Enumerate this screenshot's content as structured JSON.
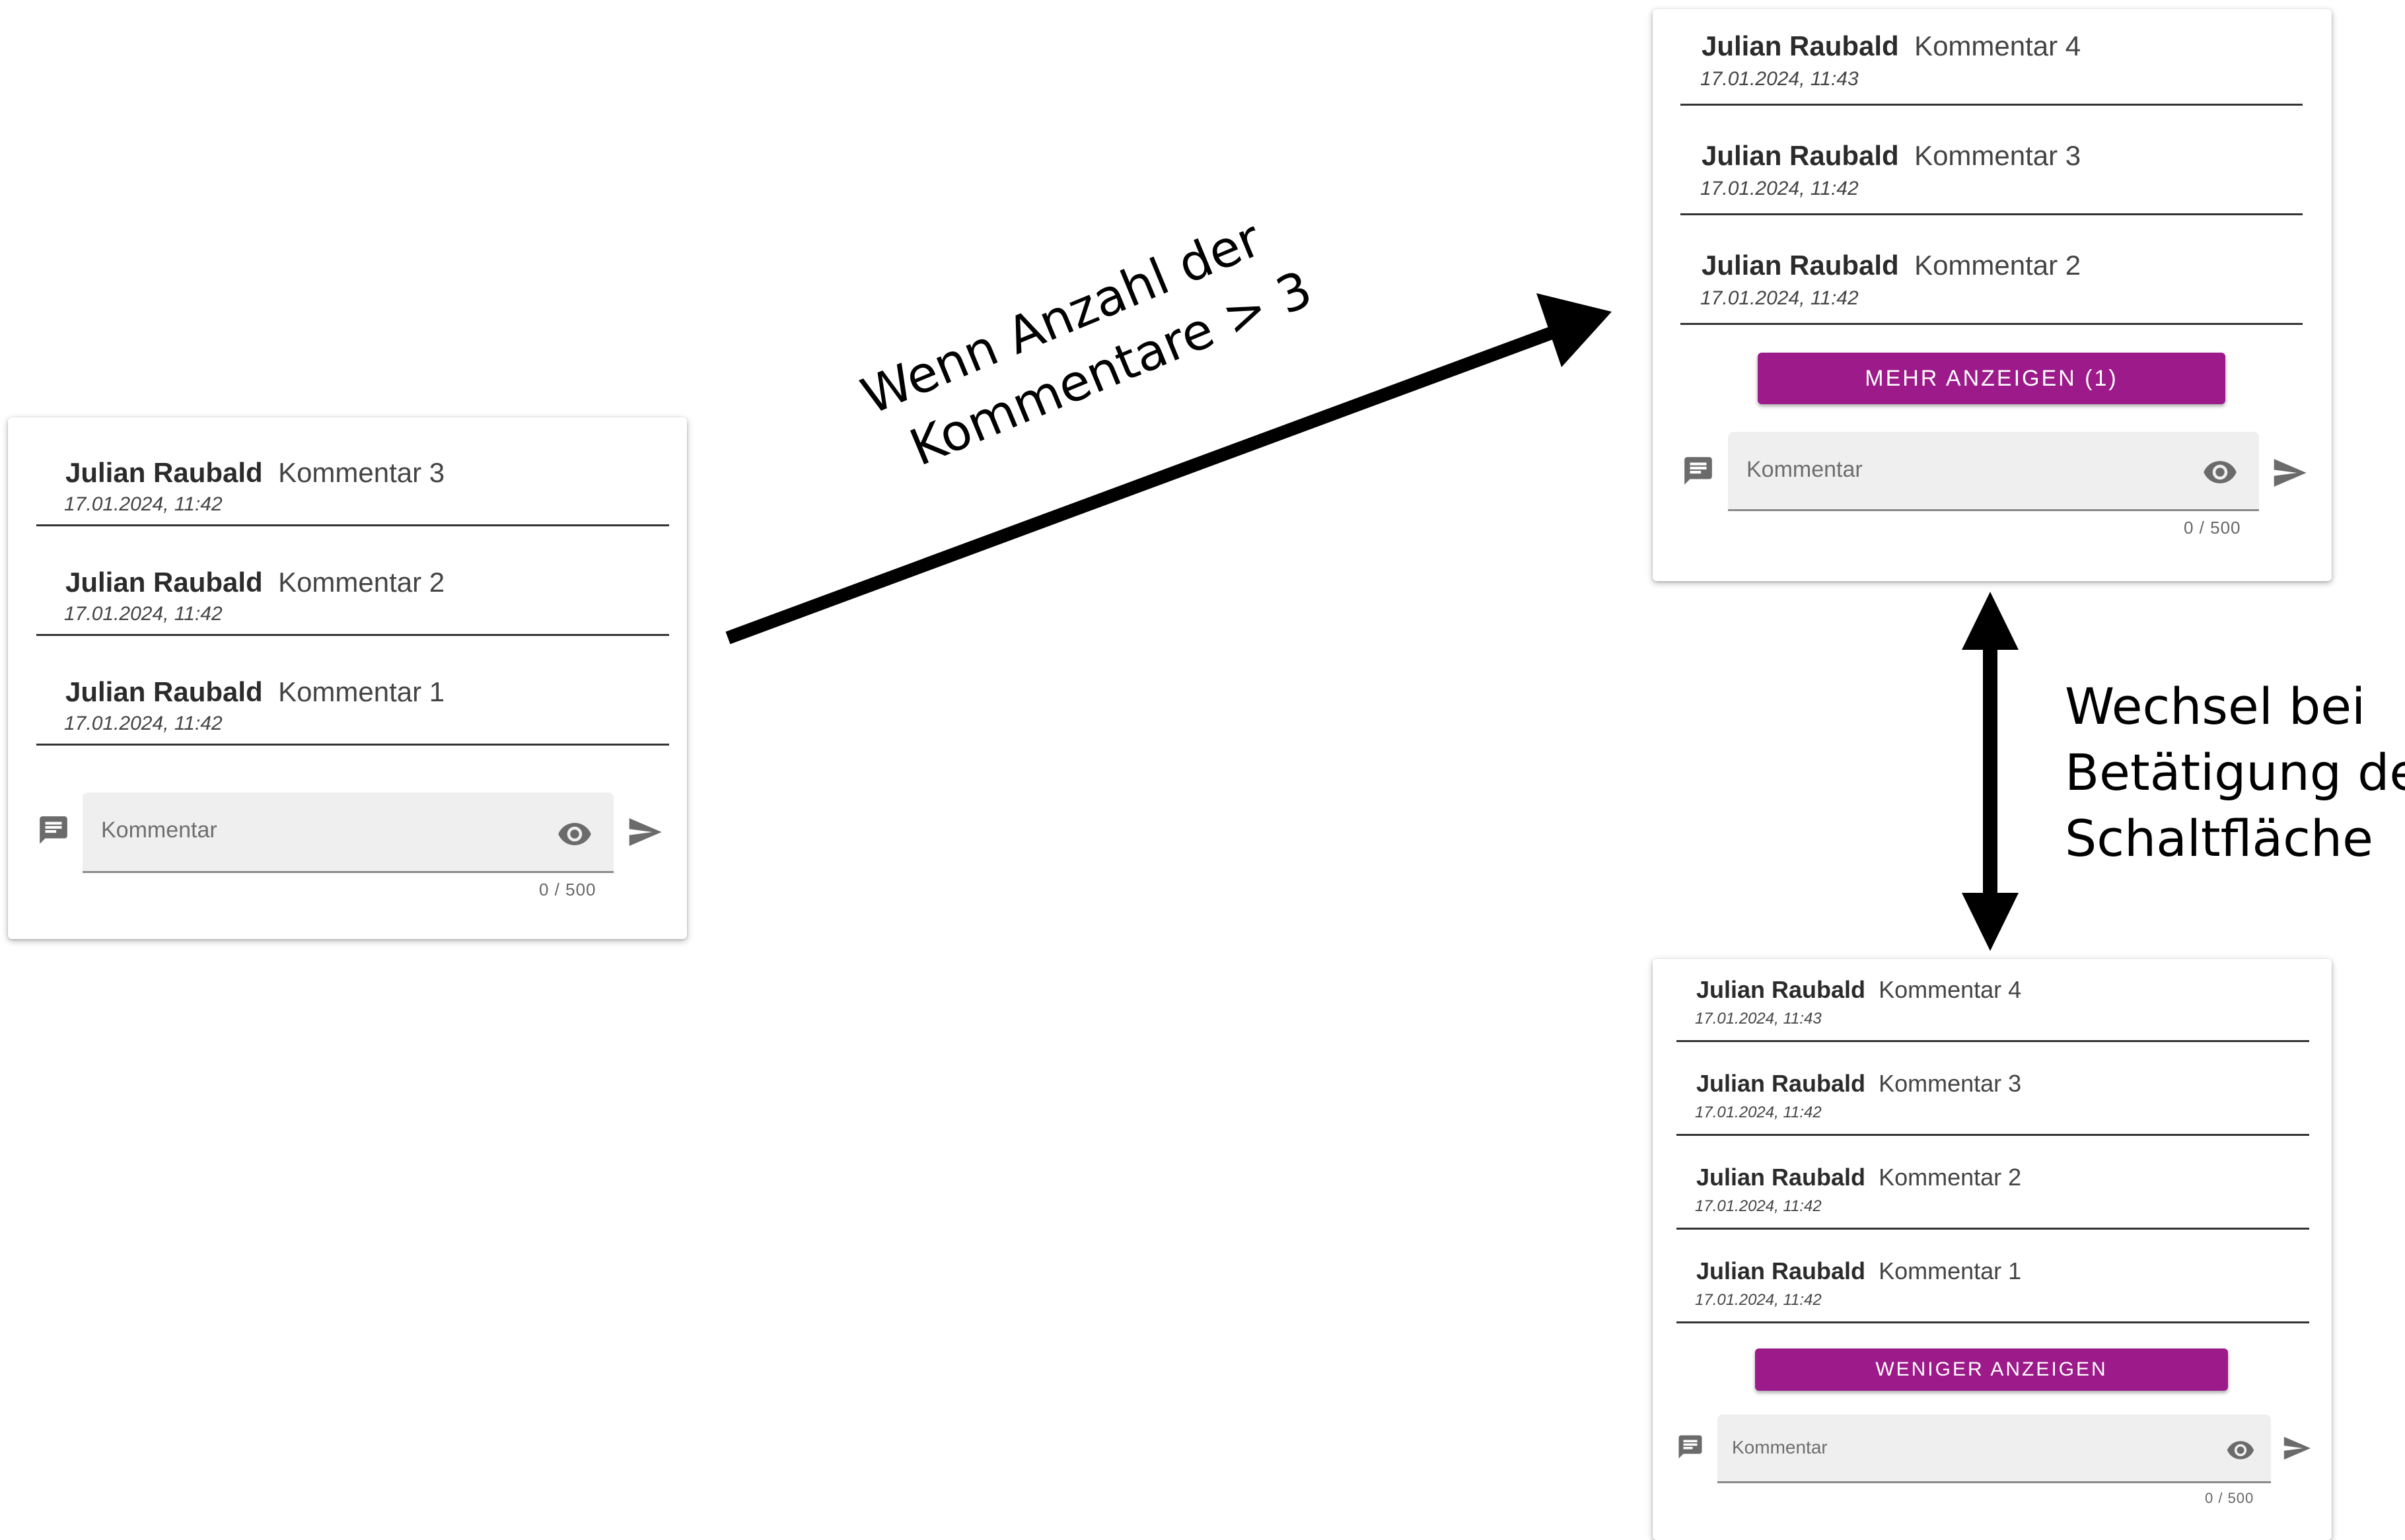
{
  "panels": {
    "initial": {
      "comments": [
        {
          "author": "Julian Raubald",
          "text": "Kommentar 3",
          "date": "17.01.2024, 11:42"
        },
        {
          "author": "Julian Raubald",
          "text": "Kommentar 2",
          "date": "17.01.2024, 11:42"
        },
        {
          "author": "Julian Raubald",
          "text": "Kommentar 1",
          "date": "17.01.2024, 11:42"
        }
      ],
      "input": {
        "placeholder": "Kommentar",
        "counter": "0 / 500"
      }
    },
    "collapsed": {
      "comments": [
        {
          "author": "Julian Raubald",
          "text": "Kommentar 4",
          "date": "17.01.2024, 11:43"
        },
        {
          "author": "Julian Raubald",
          "text": "Kommentar 3",
          "date": "17.01.2024, 11:42"
        },
        {
          "author": "Julian Raubald",
          "text": "Kommentar 2",
          "date": "17.01.2024, 11:42"
        }
      ],
      "button_label": "MEHR ANZEIGEN (1)",
      "input": {
        "placeholder": "Kommentar",
        "counter": "0 / 500"
      }
    },
    "expanded": {
      "comments": [
        {
          "author": "Julian Raubald",
          "text": "Kommentar 4",
          "date": "17.01.2024, 11:43"
        },
        {
          "author": "Julian Raubald",
          "text": "Kommentar 3",
          "date": "17.01.2024, 11:42"
        },
        {
          "author": "Julian Raubald",
          "text": "Kommentar 2",
          "date": "17.01.2024, 11:42"
        },
        {
          "author": "Julian Raubald",
          "text": "Kommentar 1",
          "date": "17.01.2024, 11:42"
        }
      ],
      "button_label": "WENIGER ANZEIGEN",
      "input": {
        "placeholder": "Kommentar",
        "counter": "0 / 500"
      }
    }
  },
  "annotations": {
    "transition_line1": "Wenn Anzahl der",
    "transition_line2": "Kommentare > 3",
    "toggle_line1": "Wechsel bei",
    "toggle_line2": "Betätigung der",
    "toggle_line3": "Schaltfläche"
  },
  "colors": {
    "button": "#9c1a8a",
    "divider": "#333333",
    "field_bg": "#efefef",
    "icon": "#6b6b6b"
  },
  "icons": [
    "comment-icon",
    "eye-icon",
    "send-icon"
  ]
}
